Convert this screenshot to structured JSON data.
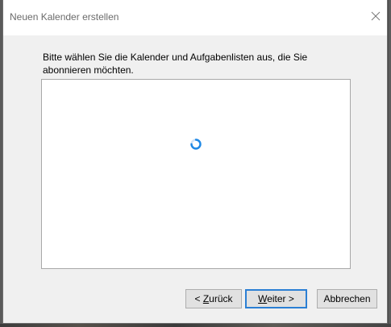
{
  "dialog": {
    "title": "Neuen Kalender erstellen",
    "instruction": "Bitte wählen Sie die Kalender und Aufgabenlisten aus, die Sie abonnieren möchten.",
    "listbox": {
      "state": "loading",
      "loading_icon": "spinner-icon"
    },
    "buttons": {
      "back": {
        "prefix": "< ",
        "accel": "Z",
        "rest": "urück"
      },
      "next": {
        "accel": "W",
        "rest": "eiter >"
      },
      "cancel": {
        "label": "Abbrechen"
      }
    },
    "close_icon": "close-icon",
    "colors": {
      "accent": "#2b7fd4",
      "spinner": "#1e88e5"
    }
  }
}
